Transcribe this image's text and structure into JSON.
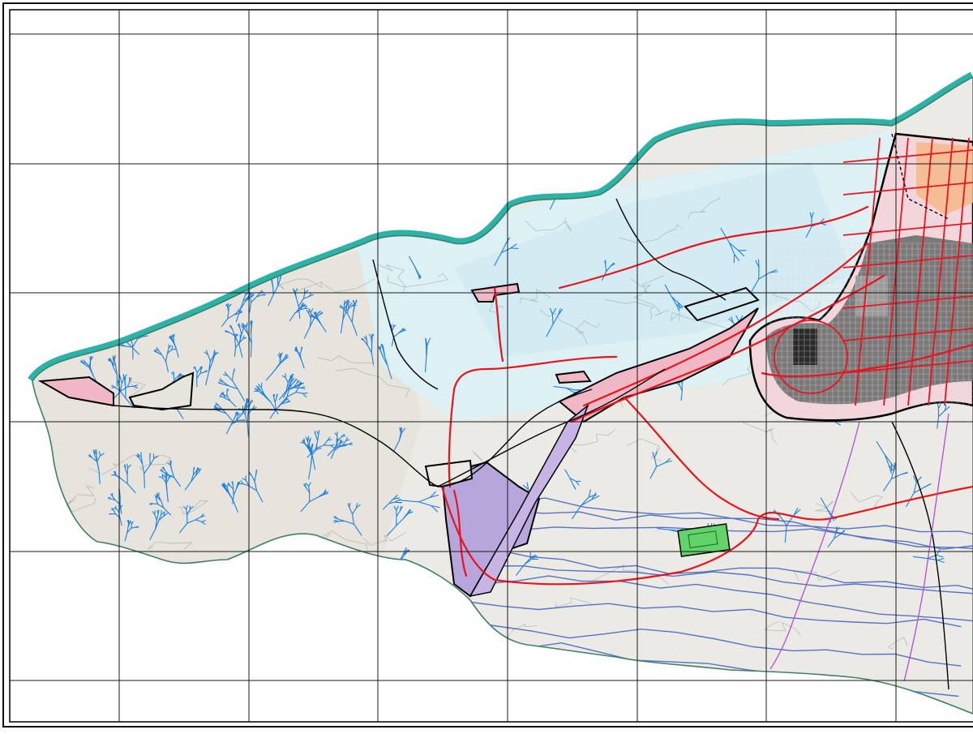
{
  "map": {
    "colors": {
      "background": "#ffffff",
      "frame": "#111111",
      "grid": "#1a1a1a",
      "terrain_west": "#e6e4dc",
      "terrain_central": "#ddf0f4",
      "terrain_south": "#eceae4",
      "river_fringe": "#2bb3a8",
      "fringe_green": "#8fc06a",
      "stream_blue": "#1f7fe0",
      "main_roads": "#e8141e",
      "urban_grey": "#6e6e6e",
      "urban_dark": "#2a2a2a",
      "zone_pink": "#f0b8c4",
      "zone_lavender": "#b7a6dc",
      "zone_orange": "#f4b98a",
      "zone_green": "#62d26a",
      "boundary": "#000000",
      "power_line": "#b04ee0",
      "contour_grey": "#8a8a8a"
    },
    "icons": {
      "frame": "map-frame",
      "grid": "coordinate-grid",
      "urban": "urban-area"
    }
  }
}
